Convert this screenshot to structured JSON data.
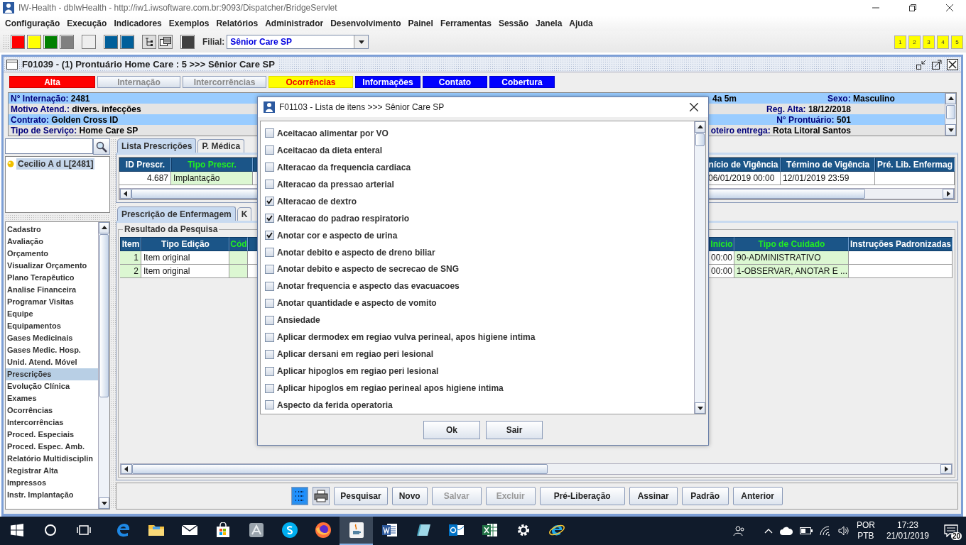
{
  "window": {
    "title": "IW-Health - dbIwHealth - http://iw1.iwsoftware.com.br:9093/Dispatcher/BridgeServlet"
  },
  "menu": [
    "Configuração",
    "Execução",
    "Indicadores",
    "Exemplos",
    "Relatórios",
    "Administrador",
    "Desenvolvimento",
    "Painel",
    "Ferramentas",
    "Sessão",
    "Janela",
    "Ajuda"
  ],
  "toolbar": {
    "buttons": [
      {
        "kind": "swatch",
        "color": "#ff0000"
      },
      {
        "kind": "swatch",
        "color": "#ffff00"
      },
      {
        "kind": "swatch",
        "color": "#008000"
      },
      {
        "kind": "swatch",
        "color": "#808080"
      },
      {
        "kind": "swatch",
        "color": "#eeeeee"
      },
      {
        "kind": "swatch",
        "color": "#005f9a"
      },
      {
        "kind": "swatch",
        "color": "#005f9a"
      },
      {
        "kind": "tree"
      },
      {
        "kind": "windows"
      },
      {
        "kind": "swatch",
        "color": "#404040"
      }
    ],
    "filial_label": "Filial:",
    "filial_value": "Sênior Care SP",
    "pages": [
      "1",
      "2",
      "3",
      "4",
      "5"
    ]
  },
  "frame": {
    "title": "F01039 - (1) Prontuário Home Care : 5 >>> Sênior Care SP",
    "status_buttons": [
      {
        "label": "Alta",
        "kind": "danger"
      },
      {
        "label": "Internação",
        "kind": "inactive"
      },
      {
        "label": "Intercorrências",
        "kind": "inactive"
      },
      {
        "label": "Ocorrências",
        "kind": "warning"
      },
      {
        "label": "Informações",
        "kind": "info"
      },
      {
        "label": "Contato",
        "kind": "info"
      },
      {
        "label": "Cobertura",
        "kind": "info"
      }
    ],
    "info_rows": [
      {
        "fields": [
          {
            "kind": "left",
            "label": "N° Internação:",
            "value": "2481"
          },
          {
            "kind": "partial",
            "value": "4a 5m"
          },
          {
            "kind": "far",
            "label": "Sexo:",
            "value": "Masculino"
          }
        ]
      },
      {
        "fields": [
          {
            "kind": "left",
            "label": "Motivo Atend.:",
            "value": "divers. infecções"
          },
          {
            "kind": "right",
            "label": "Reg. Alta:",
            "value": "18/12/2018"
          }
        ]
      },
      {
        "fields": [
          {
            "kind": "left",
            "label": "Contrato:",
            "value": "Golden Cross ID"
          },
          {
            "kind": "right",
            "label": "N° Prontuário:",
            "value": "501"
          }
        ]
      },
      {
        "fields": [
          {
            "kind": "left",
            "label": "Tipo de Serviço:",
            "value": "Home Care SP"
          },
          {
            "kind": "right",
            "label": "oteiro entrega:",
            "value": "Rota Litoral Santos"
          }
        ]
      }
    ],
    "patients": [
      {
        "label": "Cecilio A d L[2481]",
        "selected": true
      }
    ],
    "nav": [
      {
        "label": "Cadastro",
        "selected": false
      },
      {
        "label": "Avaliação",
        "selected": false
      },
      {
        "label": "Orçamento",
        "selected": false
      },
      {
        "label": "Visualizar Orçamento",
        "selected": false
      },
      {
        "label": "Plano Terapêutico",
        "selected": false
      },
      {
        "label": "Analise Financeira",
        "selected": false
      },
      {
        "label": "Programar Visitas",
        "selected": false
      },
      {
        "label": "Equipe",
        "selected": false
      },
      {
        "label": "Equipamentos",
        "selected": false
      },
      {
        "label": "Gases Medicinais",
        "selected": false
      },
      {
        "label": "Gases Medic. Hosp.",
        "selected": false
      },
      {
        "label": "Unid. Atend. Móvel",
        "selected": false
      },
      {
        "label": "Prescrições",
        "selected": true
      },
      {
        "label": "Evolução Clínica",
        "selected": false
      },
      {
        "label": "Exames",
        "selected": false
      },
      {
        "label": "Ocorrências",
        "selected": false
      },
      {
        "label": "Intercorrências",
        "selected": false
      },
      {
        "label": "Proced. Especiais",
        "selected": false
      },
      {
        "label": "Proced. Espec. Amb.",
        "selected": false
      },
      {
        "label": "Relatório Multidisciplin",
        "selected": false
      },
      {
        "label": "Registrar Alta",
        "selected": false
      },
      {
        "label": "Impressos",
        "selected": false
      },
      {
        "label": "Instr. Implantação",
        "selected": false
      }
    ],
    "tabs": [
      {
        "label": "Lista Prescrições",
        "selected": true
      },
      {
        "label": "P. Médica",
        "selected": false
      }
    ],
    "prescriptions": {
      "columns": [
        {
          "label": "ID Prescr.",
          "accent": false,
          "shaded": false
        },
        {
          "label": "Tipo Prescr.",
          "accent": true,
          "shaded": true
        },
        {
          "label": "nício de Vigência",
          "accent": false,
          "shaded": false
        },
        {
          "label": "Término de Vigência",
          "accent": false,
          "shaded": false
        },
        {
          "label": "Pré. Lib. Enfermag",
          "accent": false,
          "shaded": false
        }
      ],
      "rows": [
        {
          "cells": [
            "4.687",
            "Implantação",
            "06/01/2019 00:00",
            "12/01/2019 23:59",
            ""
          ]
        }
      ]
    },
    "subtabs": [
      {
        "label": "Prescrição de Enfermagem",
        "selected": true
      },
      {
        "label": "K",
        "selected": false
      }
    ],
    "result": {
      "title": "Resultado da Pesquisa",
      "columns": [
        {
          "label": "Item",
          "accent": false,
          "shaded": true
        },
        {
          "label": "Tipo Edição",
          "accent": false,
          "shaded": false
        },
        {
          "label": "Cód",
          "accent": true,
          "shaded": true
        },
        {
          "label": "Início",
          "accent": true,
          "shaded": false
        },
        {
          "label": "Tipo de Cuidado",
          "accent": true,
          "shaded": true
        },
        {
          "label": "Instruções Padronizadas",
          "accent": false,
          "shaded": false
        }
      ],
      "rows": [
        {
          "cells": [
            "1",
            "Item original",
            "",
            "00:00",
            "90-ADMINISTRATIVO",
            ""
          ]
        },
        {
          "cells": [
            "2",
            "Item original",
            "",
            "00:00",
            "1-OBSERVAR, ANOTAR E ...",
            ""
          ]
        }
      ]
    },
    "actions": [
      {
        "label": "Pesquisar",
        "disabled": false
      },
      {
        "label": "Novo",
        "disabled": false
      },
      {
        "label": "Salvar",
        "disabled": true
      },
      {
        "label": "Excluir",
        "disabled": true
      },
      {
        "label": "Pré-Liberação",
        "disabled": false
      },
      {
        "label": "Assinar",
        "disabled": false
      },
      {
        "label": "Padrão",
        "disabled": false
      },
      {
        "label": "Anterior",
        "disabled": false
      }
    ]
  },
  "dialog": {
    "title": "F01103 - Lista de itens >>> Sênior Care SP",
    "items": [
      {
        "label": "Aceitacao alimentar por VO",
        "checked": false
      },
      {
        "label": "Aceitacao da dieta enteral",
        "checked": false
      },
      {
        "label": "Alteracao da frequencia cardiaca",
        "checked": false
      },
      {
        "label": "Alteracao da pressao arterial",
        "checked": false
      },
      {
        "label": "Alteracao de dextro",
        "checked": true
      },
      {
        "label": "Alteracao do padrao respiratorio",
        "checked": true
      },
      {
        "label": "Anotar cor e aspecto de urina",
        "checked": true
      },
      {
        "label": "Anotar debito e aspecto de dreno biliar",
        "checked": false
      },
      {
        "label": "Anotar debito e aspecto de secrecao de SNG",
        "checked": false
      },
      {
        "label": "Anotar frequencia e aspecto das evacuacoes",
        "checked": false
      },
      {
        "label": "Anotar quantidade e aspecto de vomito",
        "checked": false
      },
      {
        "label": "Ansiedade",
        "checked": false
      },
      {
        "label": "Aplicar dermodex em regiao vulva perineal, apos higiene intima",
        "checked": false
      },
      {
        "label": "Aplicar dersani em regiao peri lesional",
        "checked": false
      },
      {
        "label": "Aplicar hipoglos em regiao peri lesional",
        "checked": false
      },
      {
        "label": "Aplicar hipoglos em regiao perineal apos higiene intima",
        "checked": false
      },
      {
        "label": "Aspecto da ferida operatoria",
        "checked": false
      }
    ],
    "buttons": [
      "Ok",
      "Sair"
    ]
  },
  "taskbar": {
    "input_language": "POR",
    "keyboard": "PTB",
    "time": "17:23",
    "date": "21/01/2019",
    "notifications": "20"
  }
}
